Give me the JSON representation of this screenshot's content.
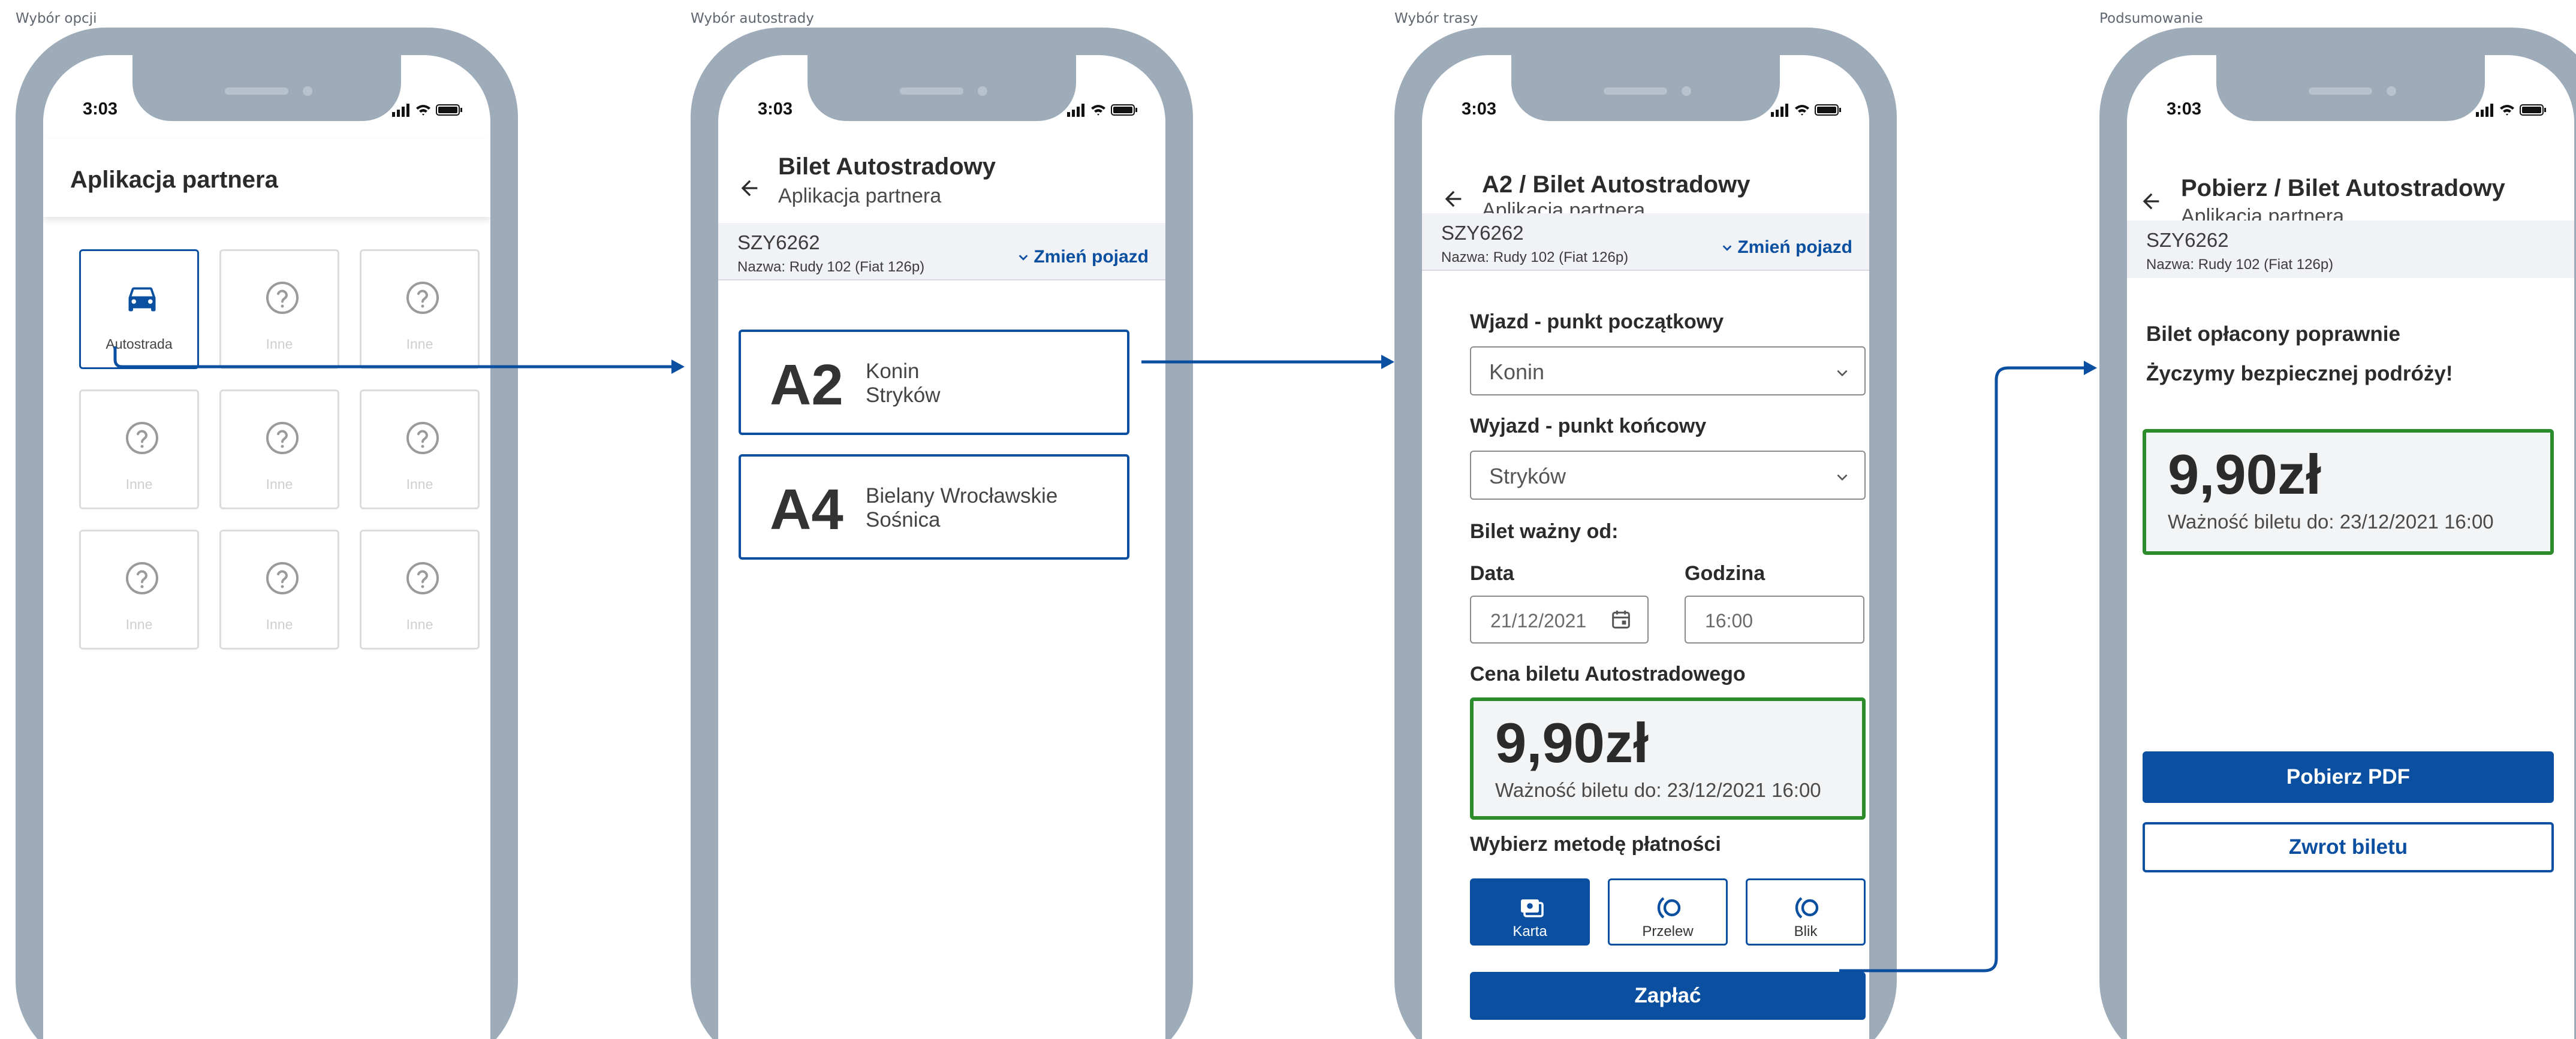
{
  "screens": {
    "s1": {
      "label": "Wybór opcji",
      "time": "3:03",
      "title": "Aplikacja partnera",
      "tiles": [
        "Autostrada",
        "Inne",
        "Inne",
        "Inne",
        "Inne",
        "Inne",
        "Inne",
        "Inne",
        "Inne"
      ]
    },
    "s2": {
      "label": "Wybór autostrady",
      "time": "3:03",
      "title": "Bilet Autostradowy",
      "subtitle": "Aplikacja partnera",
      "vehicle": {
        "plate": "SZY6262",
        "name": "Nazwa: Rudy 102 (Fiat 126p)",
        "change": "Zmień pojazd"
      },
      "routes": [
        {
          "code": "A2",
          "line1": "Konin",
          "line2": "Stryków"
        },
        {
          "code": "A4",
          "line1": "Bielany Wrocławskie",
          "line2": "Sośnica"
        }
      ]
    },
    "s3": {
      "label": "Wybór trasy",
      "time": "3:03",
      "title": "A2 / Bilet Autostradowy",
      "subtitle": "Aplikacja partnera",
      "vehicle": {
        "plate": "SZY6262",
        "name": "Nazwa: Rudy 102 (Fiat 126p)",
        "change": "Zmień pojazd"
      },
      "entry_label": "Wjazd - punkt początkowy",
      "entry_value": "Konin",
      "exit_label": "Wyjazd - punkt końcowy",
      "exit_value": "Stryków",
      "valid_from_label": "Bilet ważny od:",
      "date_label": "Data",
      "date_value": "21/12/2021",
      "time_label": "Godzina",
      "time_value": "16:00",
      "price_label": "Cena biletu Autostradowego",
      "price": "9,90zł",
      "validity": "Ważność biletu do: 23/12/2021 16:00",
      "payment_label": "Wybierz metodę płatności",
      "payment_methods": [
        "Karta",
        "Przelew",
        "Blik"
      ],
      "pay_button": "Zapłać"
    },
    "s4": {
      "label": "Podsumowanie",
      "time": "3:03",
      "title": "Pobierz / Bilet Autostradowy",
      "subtitle": "Aplikacja partnera",
      "vehicle": {
        "plate": "SZY6262",
        "name": "Nazwa: Rudy 102 (Fiat 126p)"
      },
      "paid_msg": "Bilet opłacony poprawnie",
      "wish_msg": "Życzymy bezpiecznej podróży!",
      "price": "9,90zł",
      "validity": "Ważność biletu do: 23/12/2021 16:00",
      "download_button": "Pobierz PDF",
      "refund_button": "Zwrot biletu"
    }
  },
  "colors": {
    "primary": "#0b4fa0",
    "frame": "#9eacb9",
    "success": "#2c8c2c"
  }
}
